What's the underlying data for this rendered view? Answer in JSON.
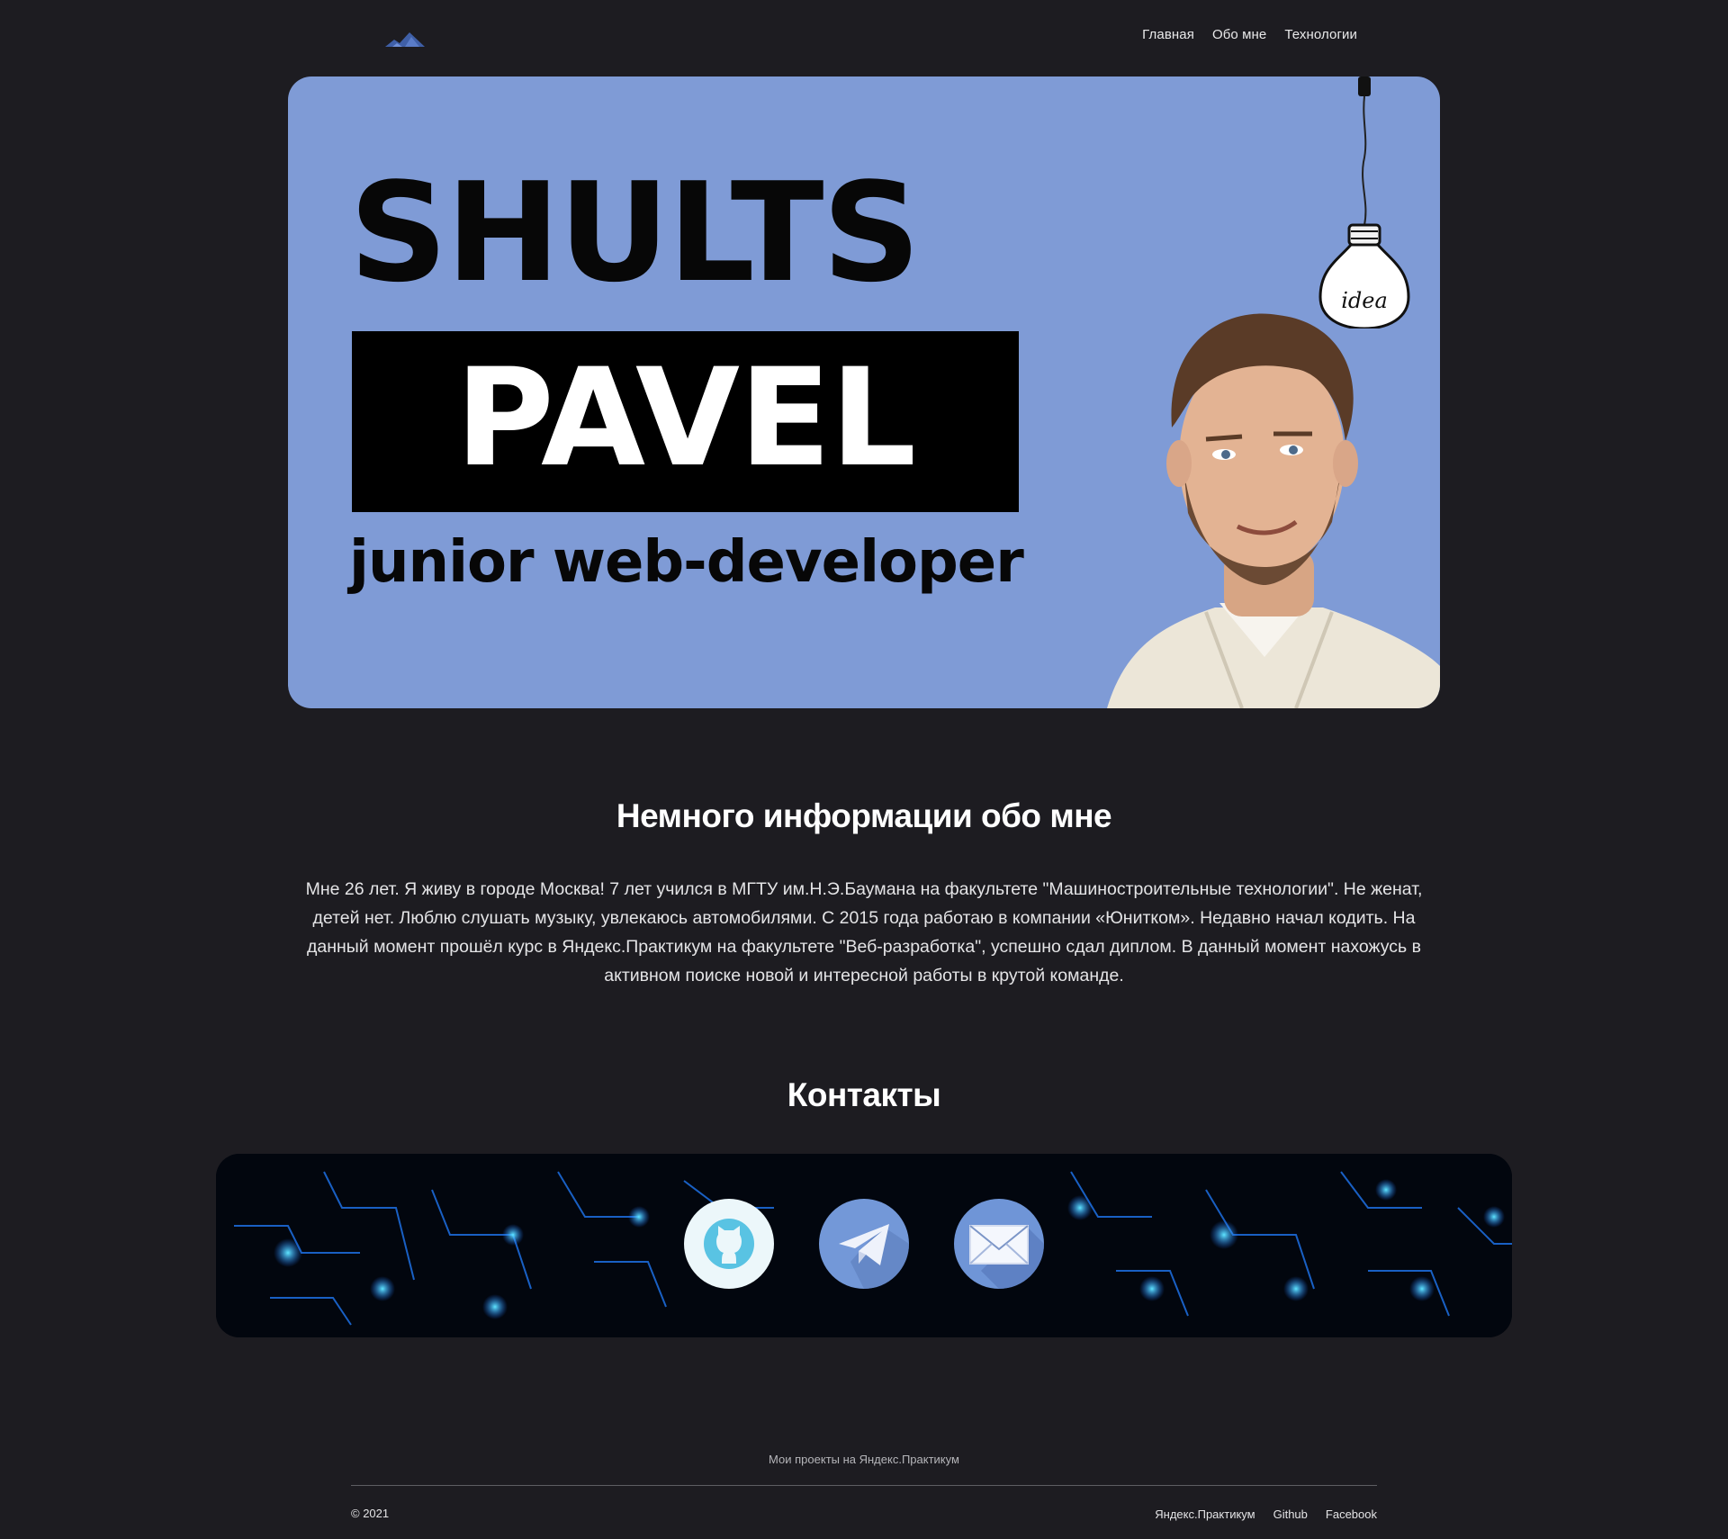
{
  "header": {
    "logo_icon": "mountains-icon",
    "nav": [
      {
        "label": "Главная"
      },
      {
        "label": "Обо мне"
      },
      {
        "label": "Технологии"
      }
    ]
  },
  "hero": {
    "surname": "SHULTS",
    "name": "PAVEL",
    "role": "junior web-developer",
    "bulb_caption": "idea",
    "background_color": "#7f9bd6"
  },
  "about": {
    "title": "Немного информации обо мне",
    "text": "Мне 26 лет. Я живу в городе Москва! 7 лет учился в МГТУ им.Н.Э.Баумана на факультете \"Машиностроительные технологии\". Не женат, детей нет. Люблю слушать музыку, увлекаюсь автомобилями. С 2015 года работаю в компании «Юнитком». Недавно начал кодить. На данный момент прошёл курс в Яндекс.Практикум на факультете \"Веб-разработка\", успешно сдал диплом. В данный момент нахожусь в активном поиске новой и интересной работы в крутой команде."
  },
  "contacts": {
    "title": "Контакты",
    "links": [
      {
        "icon": "github-icon"
      },
      {
        "icon": "telegram-icon"
      },
      {
        "icon": "mail-icon"
      }
    ]
  },
  "footer": {
    "caption": "Мои проекты на Яндекс.Практикум",
    "copyright": "© 2021",
    "links": [
      {
        "label": "Яндекс.Практикум"
      },
      {
        "label": "Github"
      },
      {
        "label": "Facebook"
      }
    ]
  }
}
